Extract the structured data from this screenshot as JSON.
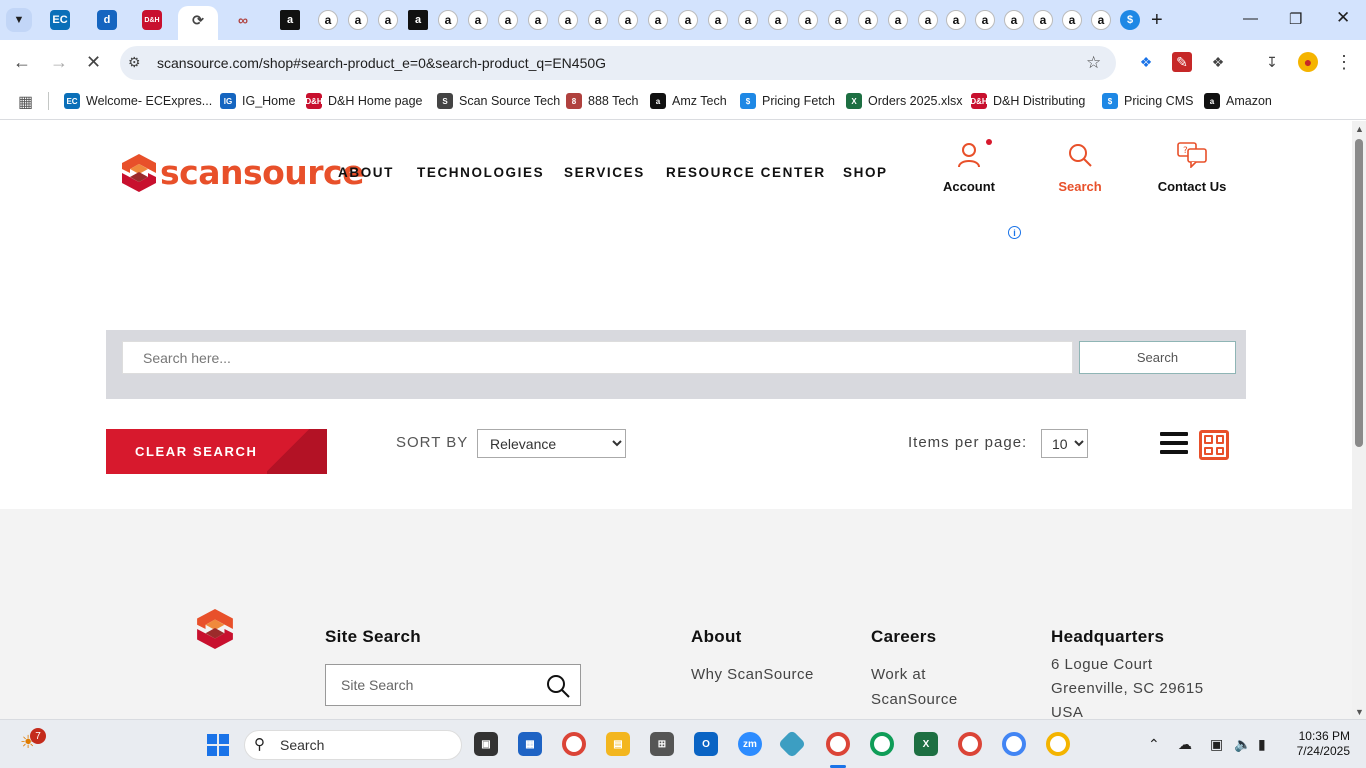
{
  "browser": {
    "tab_count_hint": "many tabs",
    "new_tab": "+",
    "url": "scansource.com/shop#search-product_e=0&search-product_q=EN450G",
    "bookmarks": [
      {
        "label": "Welcome- ECExpres...",
        "color": "#0a6fb8",
        "icon": "EC"
      },
      {
        "label": "IG_Home",
        "color": "#1565c0",
        "icon": "IG"
      },
      {
        "label": "D&H Home page",
        "color": "#c8102e",
        "icon": "D&H"
      },
      {
        "label": "Scan Source Tech",
        "color": "#444444",
        "icon": "S"
      },
      {
        "label": "888 Tech",
        "color": "#b0413e",
        "icon": "8"
      },
      {
        "label": "Amz Tech",
        "color": "#111111",
        "icon": "a"
      },
      {
        "label": "Pricing Fetch",
        "color": "#1e88e5",
        "icon": "$"
      },
      {
        "label": "Orders 2025.xlsx",
        "color": "#1d6f42",
        "icon": "X"
      },
      {
        "label": "D&H Distributing",
        "color": "#c8102e",
        "icon": "D&H"
      },
      {
        "label": "Pricing CMS",
        "color": "#1e88e5",
        "icon": "$"
      },
      {
        "label": "Amazon",
        "color": "#111111",
        "icon": "a"
      }
    ]
  },
  "site": {
    "logo_text": "scansource",
    "brand_color": "#e8502a",
    "nav": [
      "ABOUT",
      "TECHNOLOGIES",
      "SERVICES",
      "RESOURCE CENTER",
      "SHOP"
    ],
    "utility": {
      "account": "Account",
      "search": "Search",
      "contact": "Contact Us"
    }
  },
  "search": {
    "placeholder": "Search here...",
    "button": "Search"
  },
  "controls": {
    "clear": "CLEAR SEARCH",
    "sort_label": "SORT BY",
    "sort_value": "Relevance",
    "ipp_label": "Items per page:",
    "ipp_value": "10"
  },
  "footer": {
    "site_search_heading": "Site Search",
    "site_search_placeholder": "Site Search",
    "about_heading": "About",
    "about_link": "Why ScanSource",
    "careers_heading": "Careers",
    "careers_link": "Work at ScanSource",
    "hq_heading": "Headquarters",
    "hq_line1": "6 Logue Court",
    "hq_line2": "Greenville, SC 29615",
    "hq_line3": "USA"
  },
  "taskbar": {
    "weather_badge": "7",
    "search_label": "Search",
    "time": "10:36 PM",
    "date": "7/24/2025"
  }
}
